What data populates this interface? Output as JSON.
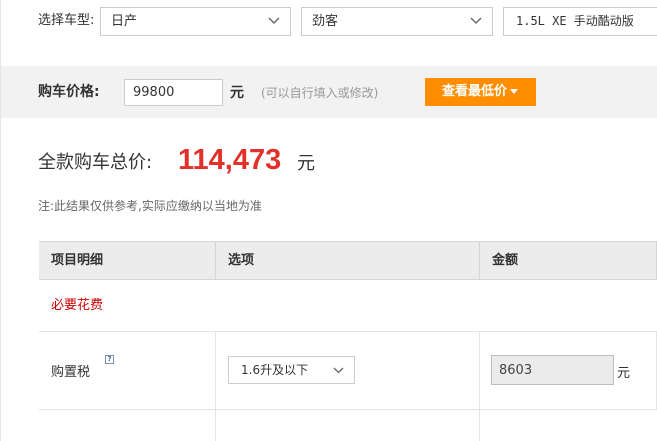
{
  "model_selector": {
    "label": "选择车型:",
    "brand": "日产",
    "series": "劲客",
    "model": "1.5L XE 手动酷动版"
  },
  "price": {
    "label": "购车价格:",
    "value": "99800",
    "unit": "元",
    "hint": "(可以自行填入或修改)",
    "best_price_button": "查看最低价"
  },
  "total": {
    "label": "全款购车总价:",
    "value": "114,473",
    "unit": "元",
    "note": "注:此结果仅供参考,实际应缴纳以当地为准"
  },
  "cost_table": {
    "headers": [
      "项目明细",
      "选项",
      "金额"
    ],
    "section_title": "必要花费",
    "rows": [
      {
        "item": "购置税",
        "help_icon": "?",
        "option": "1.6升及以下",
        "amount": "8603",
        "unit": "元"
      }
    ]
  },
  "colors": {
    "accent_orange": "#ff8d00",
    "total_red": "#e2312a",
    "section_red": "#cc0000",
    "band_gray": "#f2f2f2"
  },
  "icons": [
    "chevron-down-icon",
    "caret-down-icon",
    "help-icon"
  ]
}
